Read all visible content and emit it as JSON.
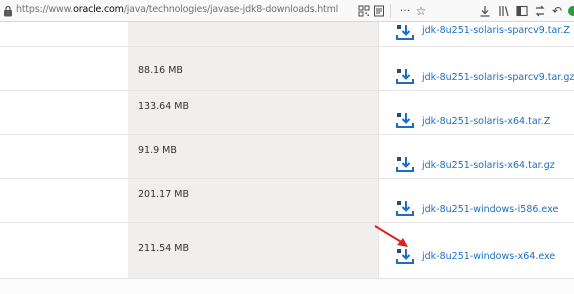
{
  "browser": {
    "url_prefix": "https://www.",
    "url_host": "oracle.com",
    "url_path": "/java/technologies/javase-jdk8-downloads.html",
    "icons": [
      "lock-icon",
      "qr-icon",
      "reader-icon",
      "more-icon",
      "star-icon",
      "download-icon",
      "library-icon",
      "sidebar-icon",
      "sync-icon",
      "back-icon",
      "extension-icon"
    ],
    "page_actions": "···",
    "star": "☆",
    "back": "↶"
  },
  "rows": [
    {
      "size": "",
      "file": "jdk-8u251-solaris-sparcv9.tar.Z"
    },
    {
      "size": "88.16 MB",
      "file": "jdk-8u251-solaris-sparcv9.tar.gz"
    },
    {
      "size": "133.64 MB",
      "file": "jdk-8u251-solaris-x64.tar.Z"
    },
    {
      "size": "91.9 MB",
      "file": "jdk-8u251-solaris-x64.tar.gz"
    },
    {
      "size": "201.17 MB",
      "file": "jdk-8u251-windows-i586.exe"
    },
    {
      "size": "211.54 MB",
      "file": "jdk-8u251-windows-x64.exe"
    }
  ],
  "colors": {
    "link": "#1d6ec3",
    "annotation_arrow": "#e02020",
    "size_column_bg": "#f0efed"
  }
}
